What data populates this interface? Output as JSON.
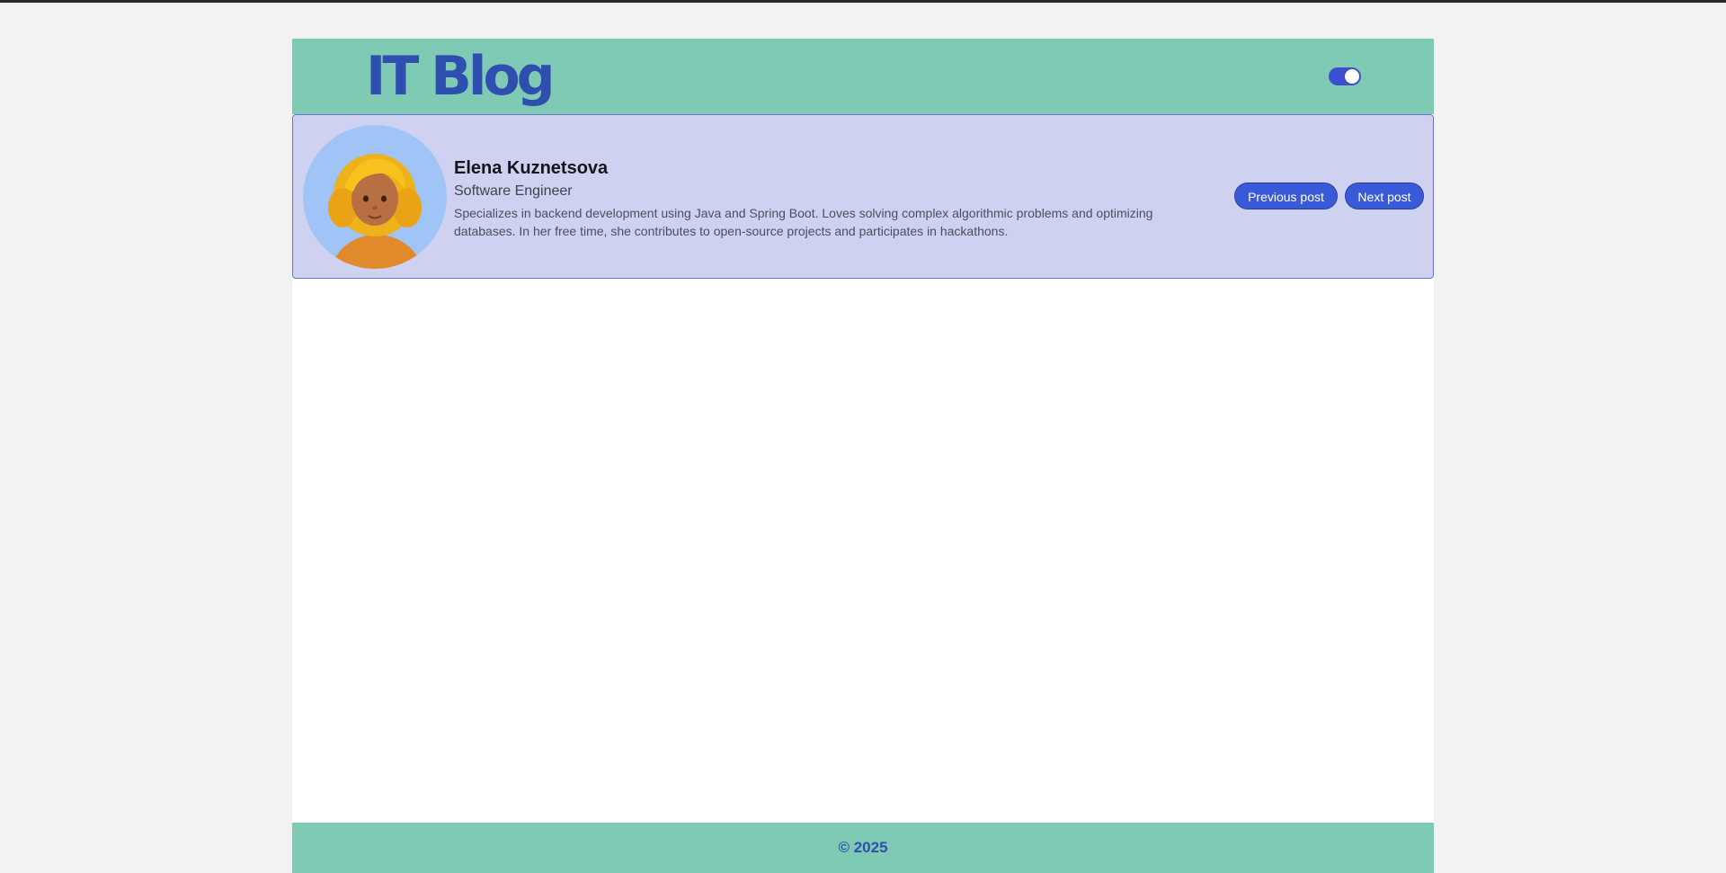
{
  "header": {
    "logo": "IT Blog",
    "theme_toggle_on": true
  },
  "author": {
    "name": "Elena Kuznetsova",
    "role": "Software Engineer",
    "bio": "Specializes in backend development using Java and Spring Boot. Loves solving complex algorithmic problems and optimizing databases. In her free time, she contributes to open-source projects and participates in hackathons.",
    "avatar_icon": "avatar-woman-icon"
  },
  "nav": {
    "prev_label": "Previous post",
    "next_label": "Next post"
  },
  "footer": {
    "copyright": "© 2025"
  },
  "colors": {
    "header_bg": "#7fcab5",
    "accent": "#2f4fb0",
    "card_bg": "#cfd1f0",
    "button_bg": "#3a5bd8"
  }
}
